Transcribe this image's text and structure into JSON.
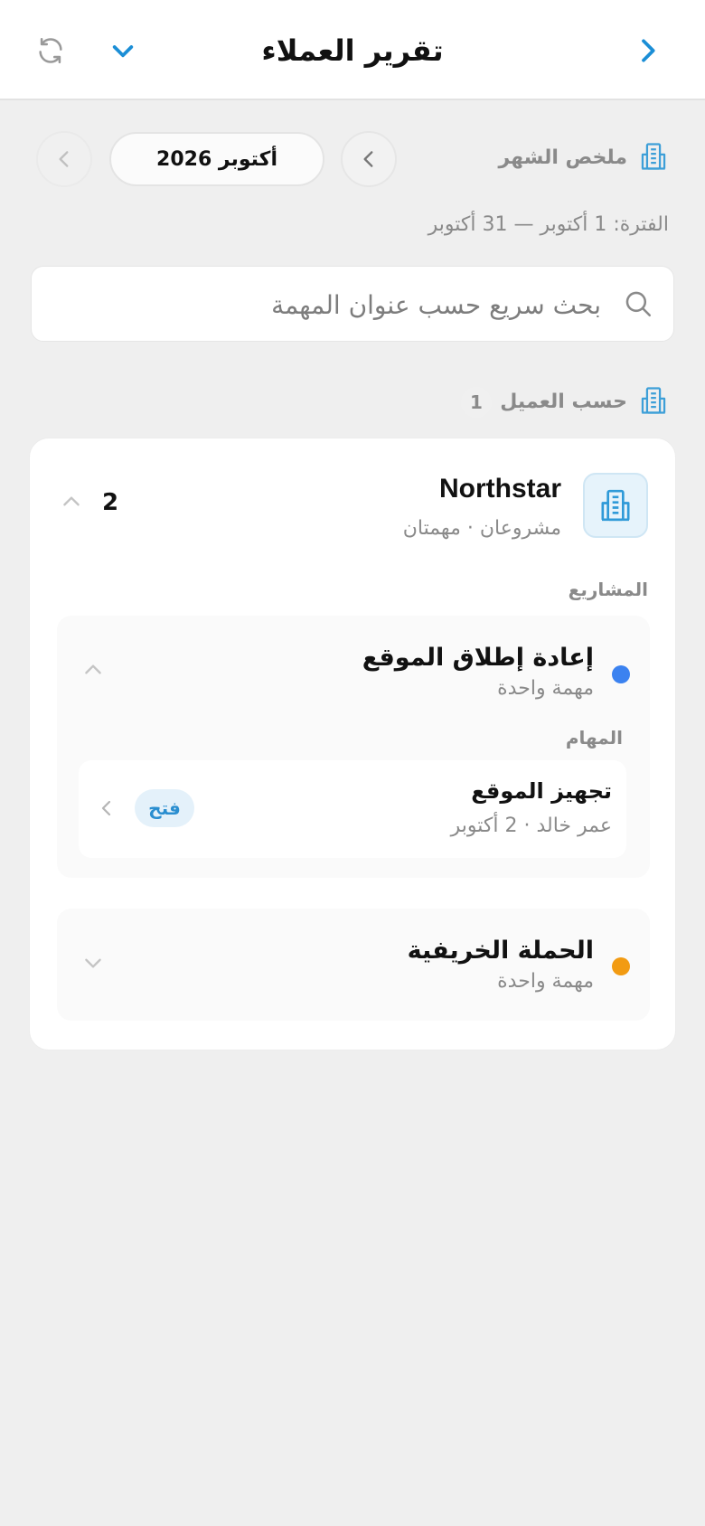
{
  "header": {
    "title": "تقرير العملاء",
    "back_icon": "chevron-right-icon",
    "dropdown_icon": "chevron-down-icon",
    "refresh_icon": "refresh-icon",
    "accent_color": "#1b8ed6"
  },
  "summary": {
    "label": "ملخص الشهر",
    "icon": "building-icon",
    "month": "أكتوبر 2026",
    "period": "الفترة: 1 أكتوبر — 31 أكتوبر"
  },
  "search": {
    "placeholder": "بحث سريع حسب عنوان المهمة",
    "value": ""
  },
  "by_client": {
    "label": "حسب العميل",
    "count": "1"
  },
  "client": {
    "name": "Northstar",
    "meta": "مشروعان · مهمتان",
    "total": "2",
    "projects_label": "المشاريع",
    "projects": [
      {
        "name": "إعادة إطلاق الموقع",
        "meta": "مهمة واحدة",
        "color": "#3b82f0",
        "expanded": true,
        "tasks_label": "المهام",
        "tasks": [
          {
            "name": "تجهيز الموقع",
            "meta": "عمر خالد  ·  2 أكتوبر",
            "status": "فتح"
          }
        ]
      },
      {
        "name": "الحملة الخريفية",
        "meta": "مهمة واحدة",
        "color": "#f29b12",
        "expanded": false
      }
    ]
  }
}
